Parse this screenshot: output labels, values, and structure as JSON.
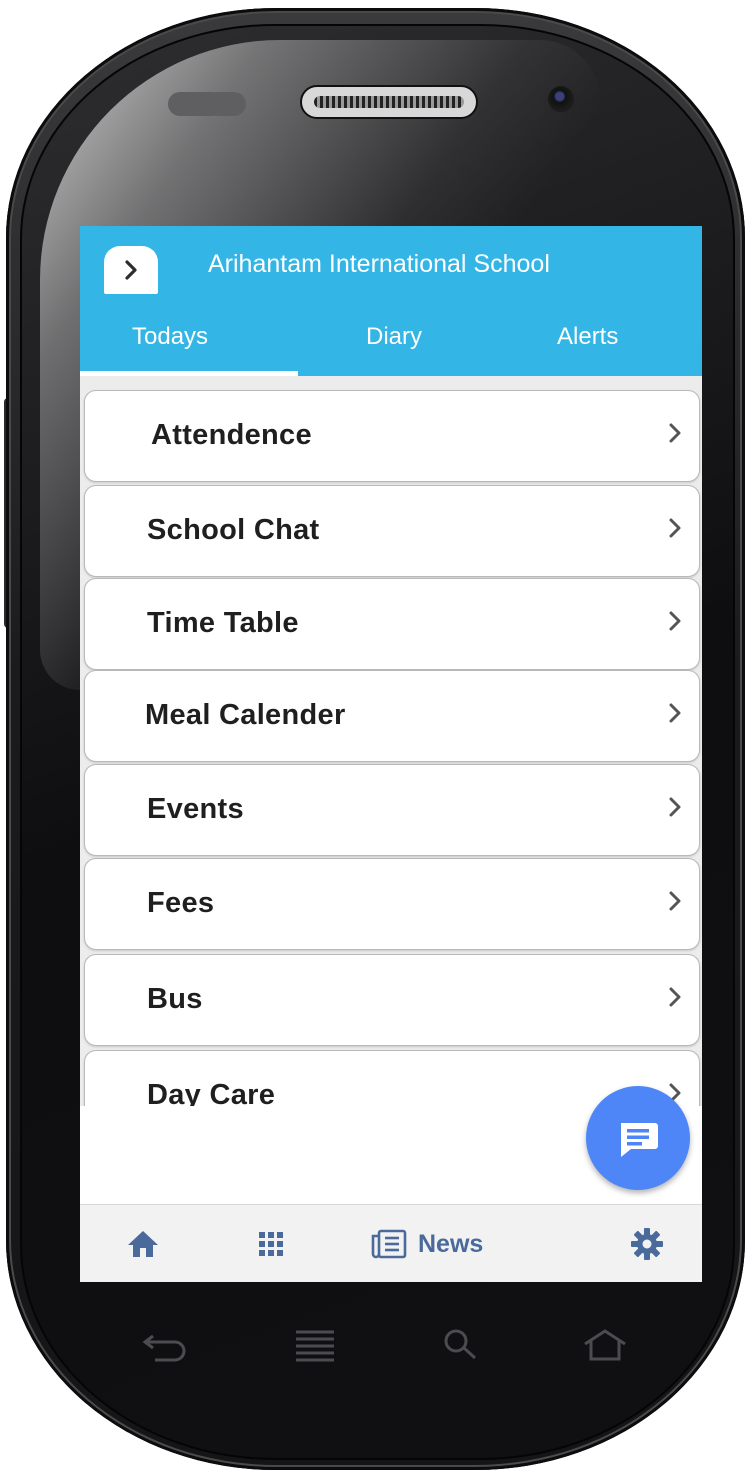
{
  "app": {
    "title": "Arihantam International School",
    "accent_color": "#33b5e5",
    "back_icon": "chevron-right-icon"
  },
  "tabs": [
    {
      "label": "Todays",
      "active": true
    },
    {
      "label": "Diary",
      "active": false
    },
    {
      "label": "Alerts",
      "active": false
    }
  ],
  "menu": {
    "items": [
      {
        "label": "Attendence"
      },
      {
        "label": "School Chat"
      },
      {
        "label": "Time Table"
      },
      {
        "label": "Meal Calender"
      },
      {
        "label": "Events"
      },
      {
        "label": "Fees"
      },
      {
        "label": "Bus"
      },
      {
        "label": "Day Care"
      }
    ]
  },
  "fab": {
    "icon": "chat-message-icon",
    "color": "#4f86f7"
  },
  "bottom_nav": {
    "items": [
      {
        "icon": "home-icon"
      },
      {
        "icon": "apps-grid-icon"
      },
      {
        "icon": "newspaper-icon",
        "label": "News"
      },
      {
        "icon": "gear-icon"
      }
    ]
  },
  "hardware_keys": [
    "back-icon",
    "menu-icon",
    "search-icon",
    "home-outline-icon"
  ]
}
